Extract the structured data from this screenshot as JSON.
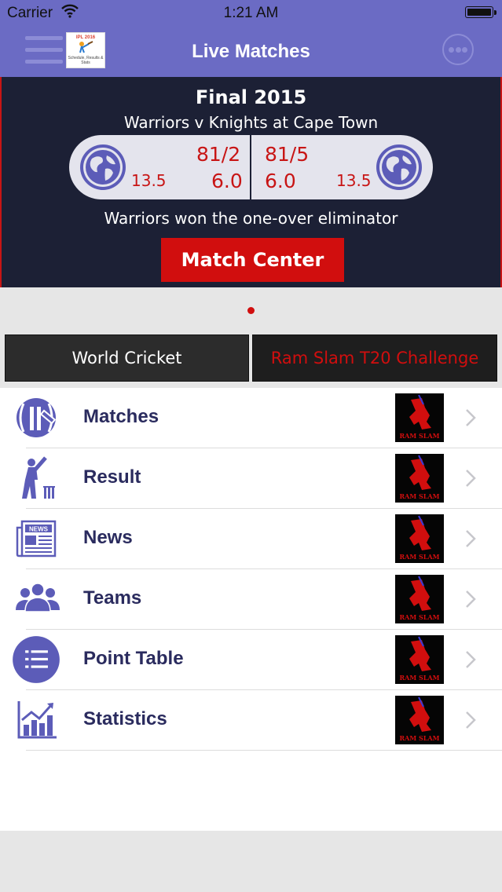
{
  "status_bar": {
    "carrier": "Carrier",
    "time": "1:21 AM"
  },
  "nav": {
    "title": "Live Matches",
    "logo_text": "IPL 2016",
    "logo_caption": "Schedule, Results & Stats"
  },
  "banner": {
    "title": "Final 2015",
    "fixture": "Warriors v Knights at Cape Town",
    "left": {
      "score": "81/2",
      "overs": "6.0",
      "rate": "13.5"
    },
    "right": {
      "score": "81/5",
      "overs": "6.0",
      "rate": "13.5"
    },
    "result": "Warriors won the one-over eliminator",
    "match_center_label": "Match Center"
  },
  "pager": {
    "pages": 1,
    "current": 1
  },
  "tabs": [
    {
      "label": "World Cricket",
      "selected": true
    },
    {
      "label": "Ram Slam T20 Challenge",
      "selected": false
    }
  ],
  "menu": [
    {
      "label": "Matches",
      "icon": "cricket-ball-icon",
      "thumb_text": "RAM SLAM"
    },
    {
      "label": "Result",
      "icon": "batsman-icon",
      "thumb_text": "RAM SLAM"
    },
    {
      "label": "News",
      "icon": "newspaper-icon",
      "thumb_text": "RAM SLAM"
    },
    {
      "label": "Teams",
      "icon": "team-icon",
      "thumb_text": "RAM SLAM"
    },
    {
      "label": "Point Table",
      "icon": "list-icon",
      "thumb_text": "RAM SLAM"
    },
    {
      "label": "Statistics",
      "icon": "chart-icon",
      "thumb_text": "RAM SLAM"
    }
  ],
  "colors": {
    "nav": "#6b6bc4",
    "banner": "#1c2035",
    "accent_red": "#d10e0e",
    "icon_blue": "#5c5cb8",
    "label": "#2a2b5e"
  }
}
